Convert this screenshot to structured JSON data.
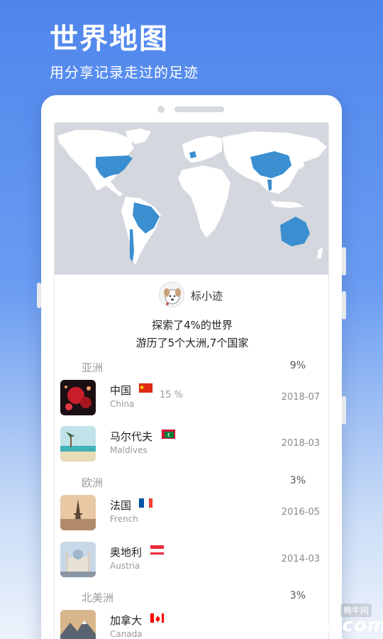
{
  "hero": {
    "title": "世界地图",
    "subtitle": "用分享记录走过的足迹"
  },
  "profile": {
    "username": "标小迹"
  },
  "stats": {
    "line1": "探索了4%的世界",
    "line2": "游历了5个大洲,7个国家"
  },
  "colors": {
    "background_top": "#4f86ec",
    "map_visited": "#3b8fd0",
    "map_unvisited": "#ffffff",
    "map_ocean": "#d4d8de"
  },
  "sections": [
    {
      "name": "亚洲",
      "percent": "9%",
      "countries": [
        {
          "name": "中国",
          "en": "China",
          "percent": "15 %",
          "date": "2018-07",
          "flag": "china-flag-icon"
        },
        {
          "name": "马尔代夫",
          "en": "Maldives",
          "percent": "",
          "date": "2018-03",
          "flag": "maldives-flag-icon"
        }
      ]
    },
    {
      "name": "欧洲",
      "percent": "3%",
      "countries": [
        {
          "name": "法国",
          "en": "French",
          "percent": "",
          "date": "2016-05",
          "flag": "france-flag-icon"
        },
        {
          "name": "奥地利",
          "en": "Austria",
          "percent": "",
          "date": "2014-03",
          "flag": "austria-flag-icon"
        }
      ]
    },
    {
      "name": "北美洲",
      "percent": "3%",
      "countries": [
        {
          "name": "加拿大",
          "en": "Canada",
          "percent": "",
          "date": "",
          "flag": "canada-flag-icon"
        }
      ]
    }
  ],
  "watermark": {
    "text": "QQTN.com",
    "cn": "腾牛网"
  }
}
